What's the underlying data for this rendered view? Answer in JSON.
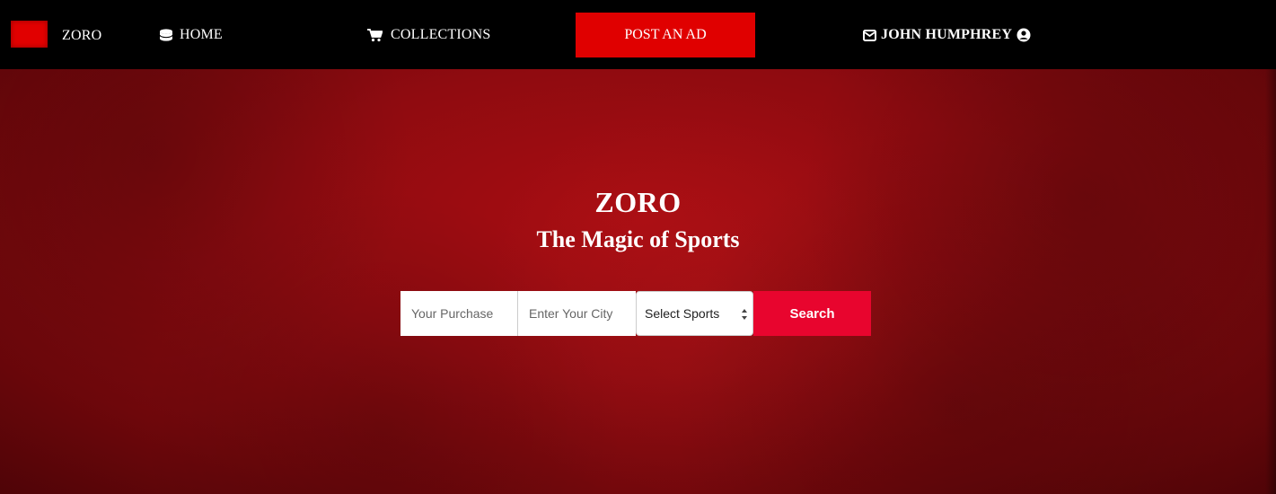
{
  "navbar": {
    "brand": "ZORO",
    "home_label": "HOME",
    "collections_label": "COLLECTIONS",
    "post_ad_label": "POST AN AD",
    "user_label": "JOHN HUMPHREY"
  },
  "hero": {
    "title": "ZORO",
    "subtitle": "The Magic of Sports"
  },
  "search": {
    "purchase_placeholder": "Your Purchase",
    "city_placeholder": "Enter Your City",
    "sports_selected": "Select Sports",
    "button_label": "Search"
  },
  "icons": {
    "home": "database-icon",
    "collections": "cart-icon",
    "mail": "envelope-icon",
    "user": "user-circle-icon"
  },
  "colors": {
    "navbar_bg": "#000000",
    "post_ad_bg": "#e00000",
    "hero_bg": "#8f0b10",
    "search_button_bg": "#e8052e"
  }
}
